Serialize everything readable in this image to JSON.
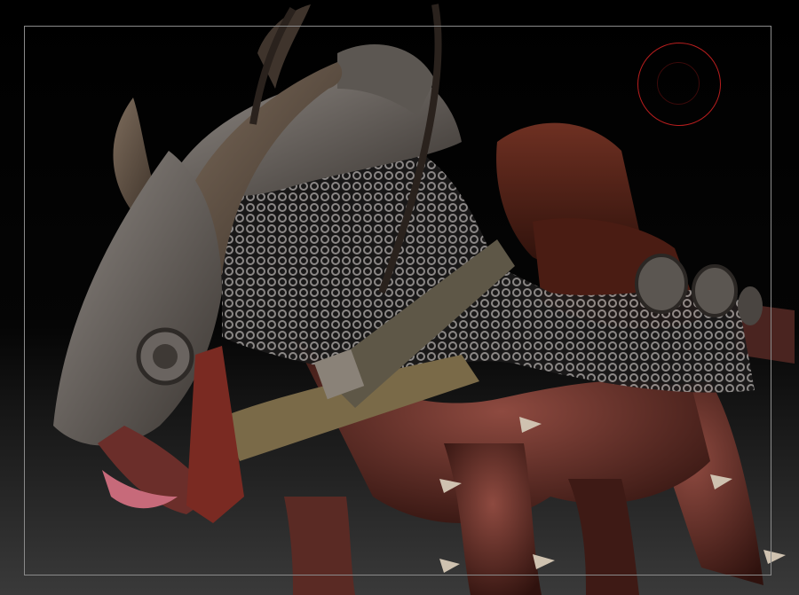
{
  "viewport": {
    "background": "#000000",
    "floor_gradient_color": "#3a3a3a",
    "frame_color": "#8a8a8a"
  },
  "model": {
    "subject": "armored-beast-sculpt",
    "colors": {
      "armor_steel": "#6f6a66",
      "armor_dark": "#3b3632",
      "chainmail": "#8e8a88",
      "saddle_leather": "#5a2418",
      "skin_red": "#7a3a32",
      "skin_dark": "#3a1612",
      "horn": "#6a5a4c",
      "tongue": "#c76a7a",
      "gold_trim": "#7a6a48"
    }
  },
  "brush_cursor": {
    "outer_color": "#b81e1e",
    "inner_color": "#3b0a0a"
  }
}
